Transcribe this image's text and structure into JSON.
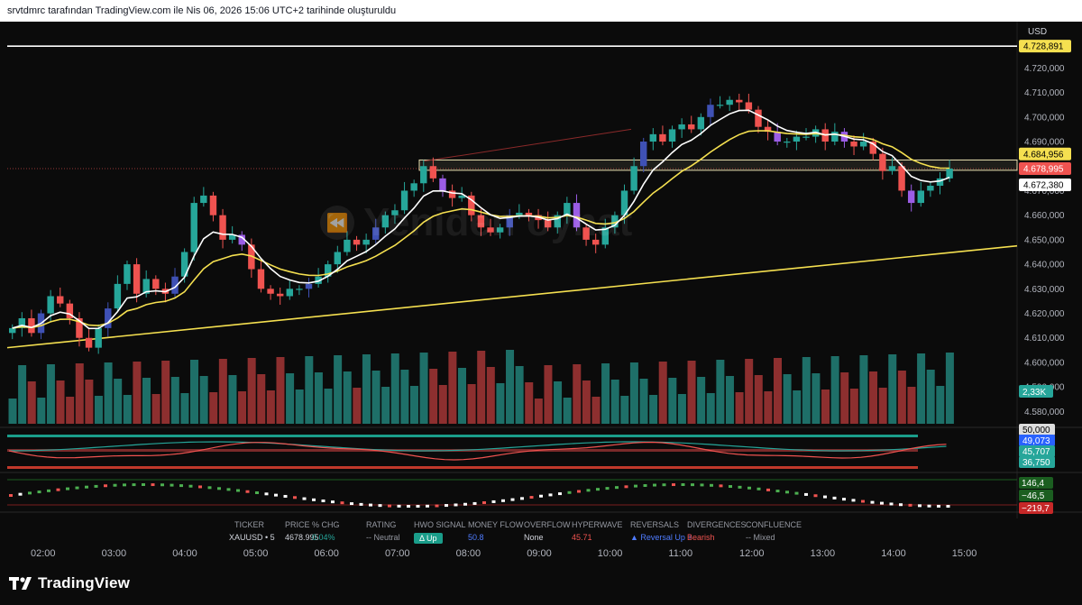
{
  "header": {
    "text": "srvtdmrc tarafından TradingView.com ile Nis 06, 2026 15:06 UTC+2 tarihinde oluşturuldu"
  },
  "currency": "USD",
  "watermark": "Yeniden oynat",
  "brand": "TradingView",
  "colors": {
    "up": "#26a69a",
    "down": "#ef5350",
    "purple": "#9b5de5",
    "blue": "#3f51b5",
    "ema_fast": "#ffffff",
    "ema_slow": "#f5e050",
    "trend": "#f5e050",
    "volume_up": "#1e6f68",
    "volume_down": "#8d2f2f"
  },
  "table": {
    "headers": [
      "TICKER",
      "PRICE",
      "% CHG",
      "RATING",
      "HWO SIGNAL",
      "MONEY FLOW",
      "OVERFLOW",
      "HYPERWAVE",
      "REVERSALS",
      "DIVERGENCES",
      "CONFLUENCE"
    ],
    "values": [
      "XAUUSD • 5",
      "4678.995",
      "0.04%",
      "-- Neutral",
      "Δ Up",
      "50.8",
      "None",
      "45.71",
      "▲ Reversal Up +",
      "Bearish",
      "-- Mixed"
    ]
  },
  "chart_data": {
    "type": "candlestick",
    "symbol": "XAUUSD • 5",
    "x_ticks": [
      "02:00",
      "03:00",
      "04:00",
      "05:00",
      "06:00",
      "07:00",
      "08:00",
      "09:00",
      "10:00",
      "11:00",
      "12:00",
      "13:00",
      "14:00",
      "15:00"
    ],
    "y_ticks": [
      "4.720,000",
      "4.710,000",
      "4.700,000",
      "4.690,000",
      "4.680,000",
      "4.670,000",
      "4.660,000",
      "4.650,000",
      "4.640,000",
      "4.630,000",
      "4.620,000",
      "4.610,000",
      "4.600,000",
      "4.590,000",
      "4.580,000"
    ],
    "ylim": [
      4575,
      4733
    ],
    "price_labels": [
      {
        "text": "4.728,891",
        "value": 4728.891,
        "style": "yellow"
      },
      {
        "text": "4.684,956",
        "value": 4684.956,
        "style": "yellow"
      },
      {
        "text": "4.678,995",
        "value": 4678.995,
        "style": "red"
      },
      {
        "text": "4.672,380",
        "value": 4672.38,
        "style": "white"
      }
    ],
    "horizontal_line": 4728.891,
    "volume_label": "2,33K",
    "candles_close": [
      4614,
      4618,
      4612,
      4620,
      4627,
      4624,
      4618,
      4610,
      4606,
      4614,
      4622,
      4632,
      4640,
      4628,
      4634,
      4630,
      4628,
      4635,
      4645,
      4665,
      4668,
      4660,
      4650,
      4652,
      4648,
      4638,
      4630,
      4628,
      4627,
      4630,
      4630,
      4632,
      4635,
      4640,
      4645,
      4650,
      4648,
      4650,
      4655,
      4660,
      4662,
      4670,
      4673,
      4680,
      4675,
      4670,
      4667,
      4668,
      4660,
      4655,
      4653,
      4655,
      4660,
      4661,
      4660,
      4658,
      4655,
      4660,
      4665,
      4655,
      4650,
      4648,
      4655,
      4660,
      4670,
      4680,
      4690,
      4693,
      4690,
      4695,
      4697,
      4695,
      4700,
      4705,
      4705,
      4707,
      4706,
      4703,
      4696,
      4694,
      4690,
      4690,
      4692,
      4692,
      4695,
      4690,
      4694,
      4690,
      4688,
      4690,
      4685,
      4678,
      4680,
      4670,
      4665,
      4670,
      4672,
      4675,
      4679
    ],
    "ema_fast_label": "EMA (white)",
    "ema_slow_label": "EMA (yellow)",
    "osc1_labels": [
      "50,000",
      "49,073",
      "45,707",
      "36,750"
    ],
    "osc2_labels": [
      "146,4",
      "−46,5",
      "−219,7"
    ]
  }
}
